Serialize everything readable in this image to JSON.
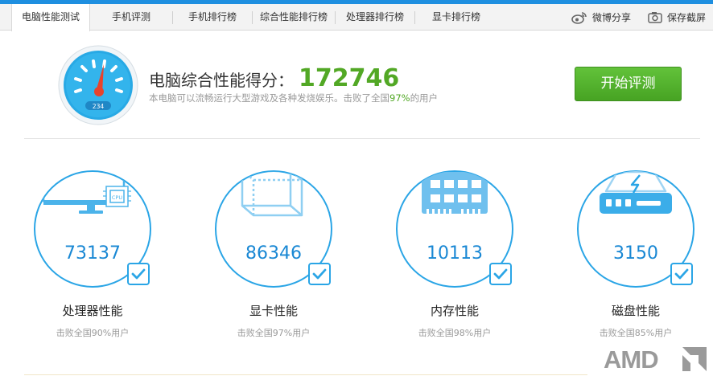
{
  "tabs": [
    {
      "label": "电脑性能测试",
      "active": true
    },
    {
      "label": "手机评测",
      "active": false
    },
    {
      "label": "手机排行榜",
      "active": false
    },
    {
      "label": "综合性能排行榜",
      "active": false
    },
    {
      "label": "处理器排行榜",
      "active": false
    },
    {
      "label": "显卡排行榜",
      "active": false
    }
  ],
  "actions": {
    "weibo_label": "微博分享",
    "weibo_icon": "weibo-icon",
    "screenshot_label": "保存截屏",
    "screenshot_icon": "camera-icon"
  },
  "gauge": {
    "readout": "234",
    "icon": "speedometer-icon"
  },
  "score": {
    "title": "电脑综合性能得分：",
    "value": "172746",
    "desc_prefix": "本电脑可以流畅运行大型游戏及各种发烧娱乐。击败了全国",
    "desc_percent": "97%",
    "desc_suffix": "的用户"
  },
  "start_button": "开始评测",
  "cards": [
    {
      "value": "73137",
      "name": "处理器性能",
      "sub": "击败全国90%用户",
      "icon": "cpu-monitor-icon",
      "chip_label": "CPU"
    },
    {
      "value": "86346",
      "name": "显卡性能",
      "sub": "击败全国97%用户",
      "icon": "graphics-cube-icon"
    },
    {
      "value": "10113",
      "name": "内存性能",
      "sub": "击败全国98%用户",
      "icon": "memory-module-icon"
    },
    {
      "value": "3150",
      "name": "磁盘性能",
      "sub": "击败全国85%用户",
      "icon": "hard-disk-icon"
    }
  ],
  "brand": {
    "logo_text": "AMD"
  },
  "colors": {
    "accent_blue": "#1a88d4",
    "score_green": "#52a825",
    "button_green": "#4fb02a"
  }
}
